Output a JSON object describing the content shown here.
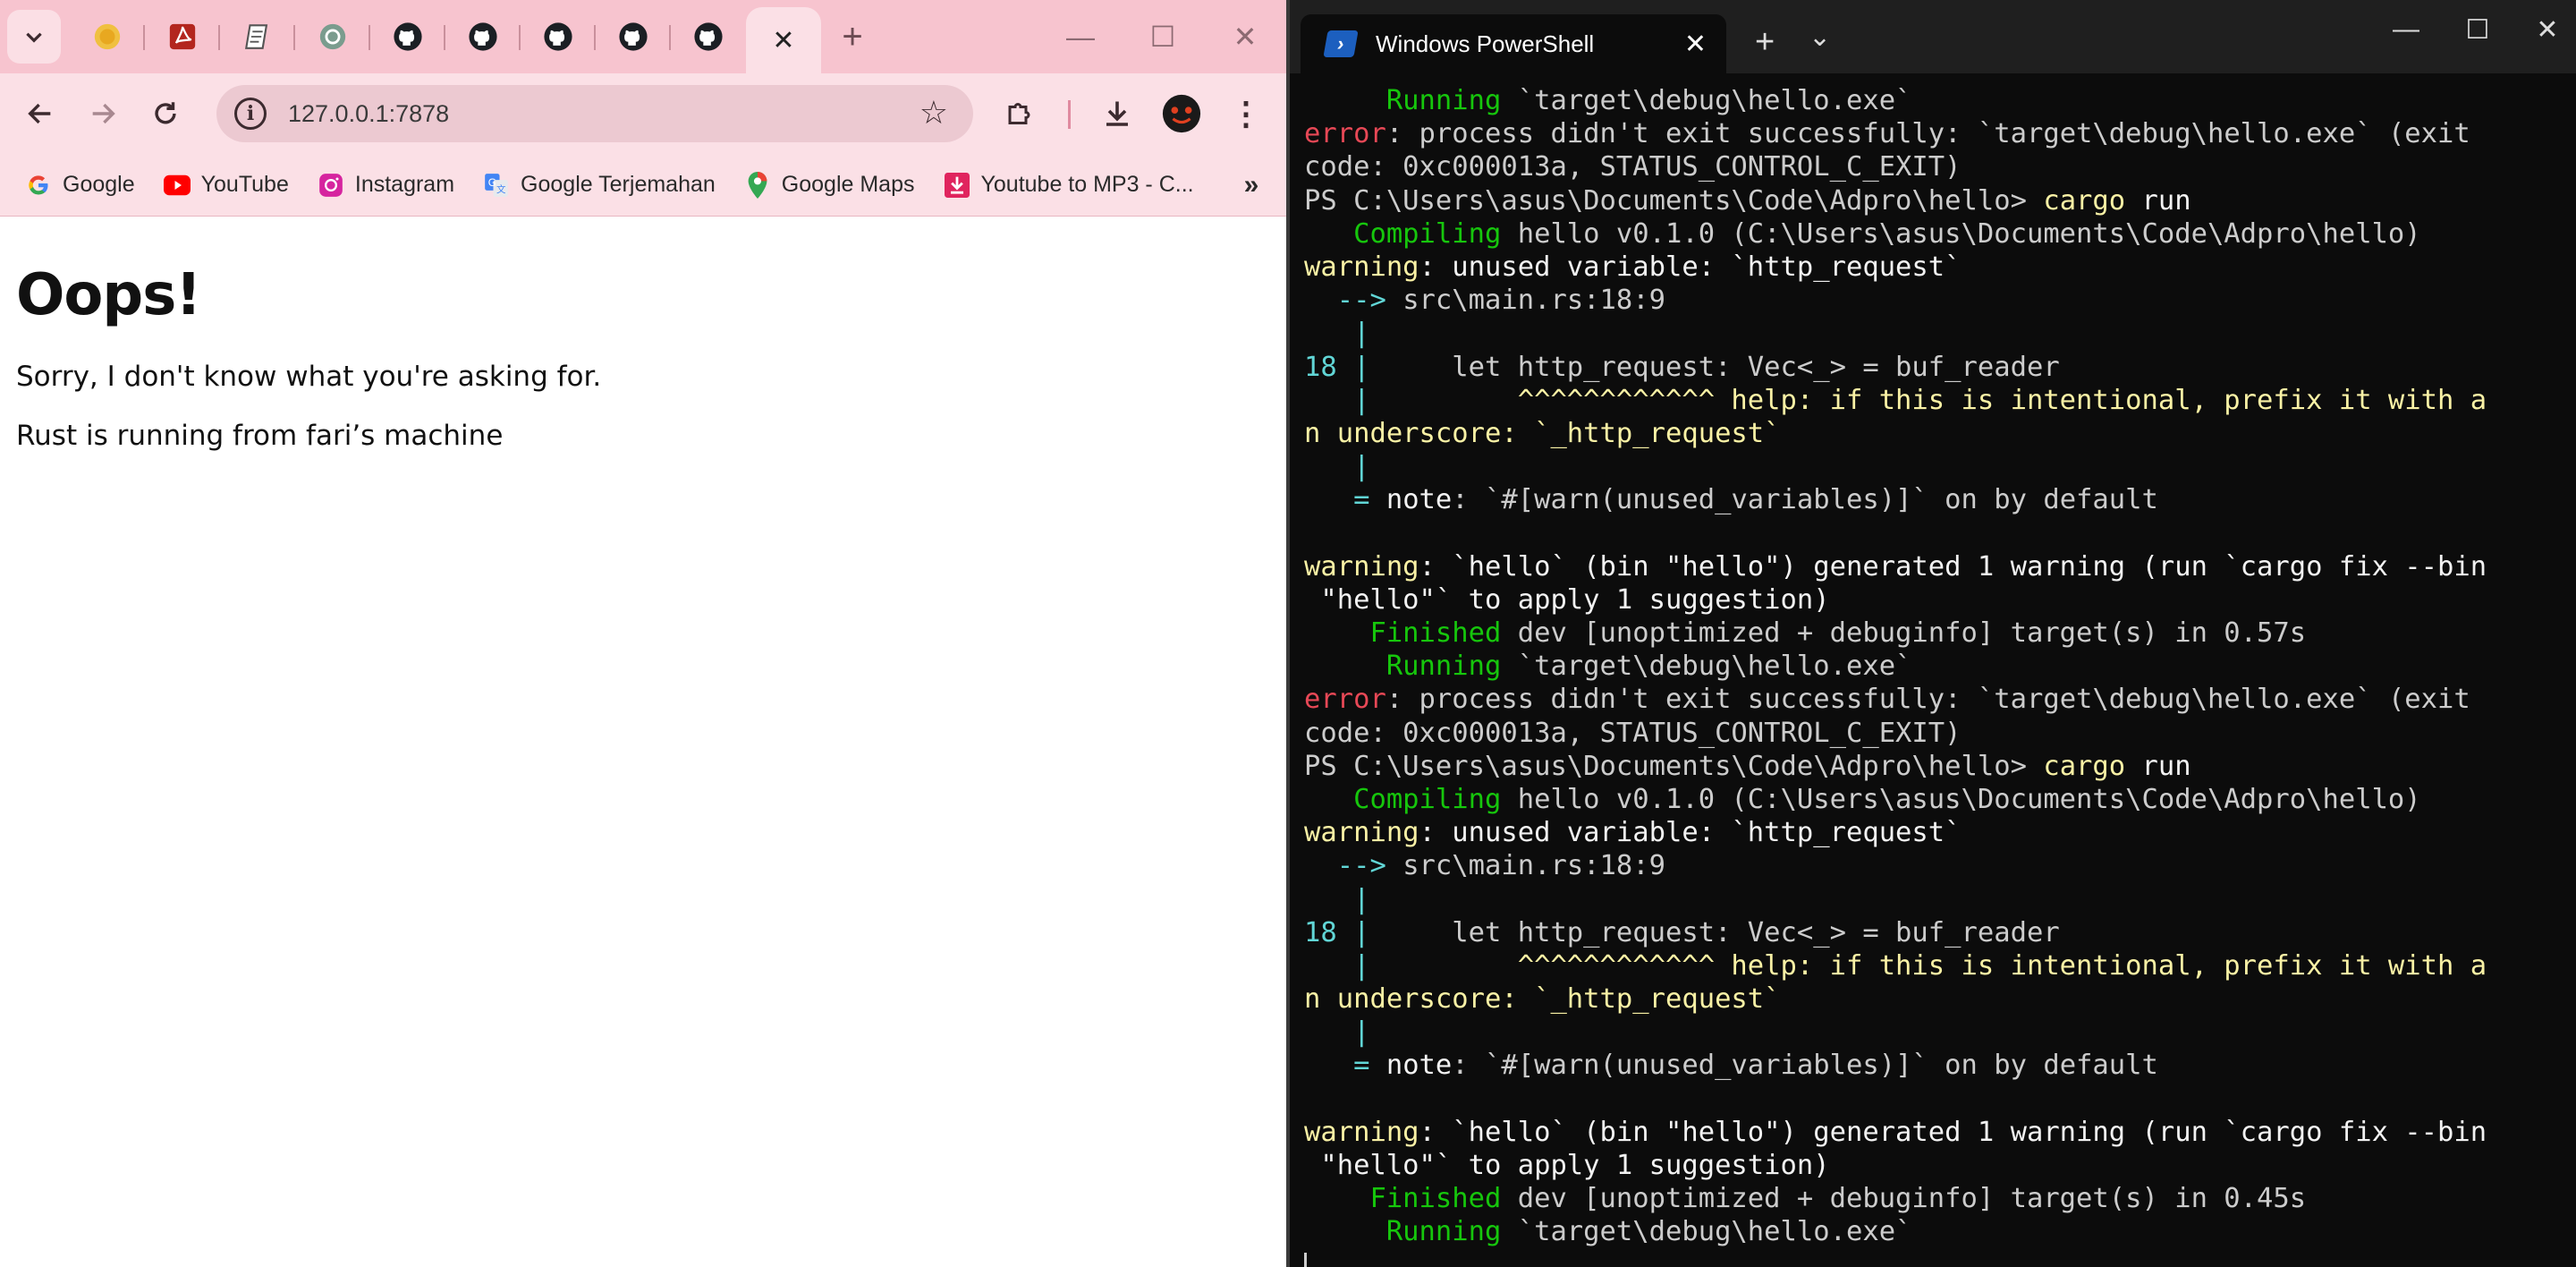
{
  "browser": {
    "address": "127.0.0.1:7878",
    "bookmarks": [
      "Google",
      "YouTube",
      "Instagram",
      "Google Terjemahan",
      "Google Maps",
      "Youtube to MP3 - C..."
    ],
    "page": {
      "heading": "Oops!",
      "line1": "Sorry, I don't know what you're asking for.",
      "line2": "Rust is running from fari’s machine"
    }
  },
  "terminal": {
    "tab_title": "Windows PowerShell",
    "lines": [
      [
        [
          "     Running",
          "g"
        ],
        [
          " `target\\debug\\hello.exe`",
          ""
        ]
      ],
      [
        [
          "error",
          "r"
        ],
        [
          ": process didn't exit successfully: `target\\debug\\hello.exe` (exit",
          ""
        ]
      ],
      [
        [
          "code: 0xc000013a, STATUS_CONTROL_C_EXIT)",
          ""
        ]
      ],
      [
        [
          "PS C:\\Users\\asus\\Documents\\Code\\Adpro\\hello> ",
          ""
        ],
        [
          "cargo",
          "y"
        ],
        [
          " run",
          "w"
        ]
      ],
      [
        [
          "   Compiling",
          "g"
        ],
        [
          " hello v0.1.0 (C:\\Users\\asus\\Documents\\Code\\Adpro\\hello)",
          ""
        ]
      ],
      [
        [
          "warning",
          "y"
        ],
        [
          ": unused variable: `http_request`",
          "w"
        ]
      ],
      [
        [
          "  -->",
          "c"
        ],
        [
          " src\\main.rs:18:9",
          ""
        ]
      ],
      [
        [
          "   |",
          "c"
        ]
      ],
      [
        [
          "18 |",
          "c"
        ],
        [
          "     let http_request: Vec<_> = buf_reader",
          ""
        ]
      ],
      [
        [
          "   |",
          "c"
        ],
        [
          "         ^^^^^^^^^^^^ help: if this is intentional, prefix it with a",
          "y"
        ]
      ],
      [
        [
          "n underscore: `_http_request`",
          "y"
        ]
      ],
      [
        [
          "   |",
          "c"
        ]
      ],
      [
        [
          "   = ",
          "c"
        ],
        [
          "note",
          "w"
        ],
        [
          ": `#[warn(unused_variables)]` on by default",
          ""
        ]
      ],
      [
        [
          "",
          ""
        ]
      ],
      [
        [
          "warning",
          "y"
        ],
        [
          ": `hello` (bin \"hello\") generated 1 warning (run `cargo fix --bin",
          "w"
        ]
      ],
      [
        [
          " \"hello\"` to apply 1 suggestion)",
          "w"
        ]
      ],
      [
        [
          "    Finished",
          "g"
        ],
        [
          " dev [unoptimized + debuginfo] target(s) in 0.57s",
          ""
        ]
      ],
      [
        [
          "     Running",
          "g"
        ],
        [
          " `target\\debug\\hello.exe`",
          ""
        ]
      ],
      [
        [
          "error",
          "r"
        ],
        [
          ": process didn't exit successfully: `target\\debug\\hello.exe` (exit",
          ""
        ]
      ],
      [
        [
          "code: 0xc000013a, STATUS_CONTROL_C_EXIT)",
          ""
        ]
      ],
      [
        [
          "PS C:\\Users\\asus\\Documents\\Code\\Adpro\\hello> ",
          ""
        ],
        [
          "cargo",
          "y"
        ],
        [
          " run",
          "w"
        ]
      ],
      [
        [
          "   Compiling",
          "g"
        ],
        [
          " hello v0.1.0 (C:\\Users\\asus\\Documents\\Code\\Adpro\\hello)",
          ""
        ]
      ],
      [
        [
          "warning",
          "y"
        ],
        [
          ": unused variable: `http_request`",
          "w"
        ]
      ],
      [
        [
          "  -->",
          "c"
        ],
        [
          " src\\main.rs:18:9",
          ""
        ]
      ],
      [
        [
          "   |",
          "c"
        ]
      ],
      [
        [
          "18 |",
          "c"
        ],
        [
          "     let http_request: Vec<_> = buf_reader",
          ""
        ]
      ],
      [
        [
          "   |",
          "c"
        ],
        [
          "         ^^^^^^^^^^^^ help: if this is intentional, prefix it with a",
          "y"
        ]
      ],
      [
        [
          "n underscore: `_http_request`",
          "y"
        ]
      ],
      [
        [
          "   |",
          "c"
        ]
      ],
      [
        [
          "   = ",
          "c"
        ],
        [
          "note",
          "w"
        ],
        [
          ": `#[warn(unused_variables)]` on by default",
          ""
        ]
      ],
      [
        [
          "",
          ""
        ]
      ],
      [
        [
          "warning",
          "y"
        ],
        [
          ": `hello` (bin \"hello\") generated 1 warning (run `cargo fix --bin",
          "w"
        ]
      ],
      [
        [
          " \"hello\"` to apply 1 suggestion)",
          "w"
        ]
      ],
      [
        [
          "    Finished",
          "g"
        ],
        [
          " dev [unoptimized + debuginfo] target(s) in 0.45s",
          ""
        ]
      ],
      [
        [
          "     Running",
          "g"
        ],
        [
          " `target\\debug\\hello.exe`",
          ""
        ]
      ]
    ]
  }
}
